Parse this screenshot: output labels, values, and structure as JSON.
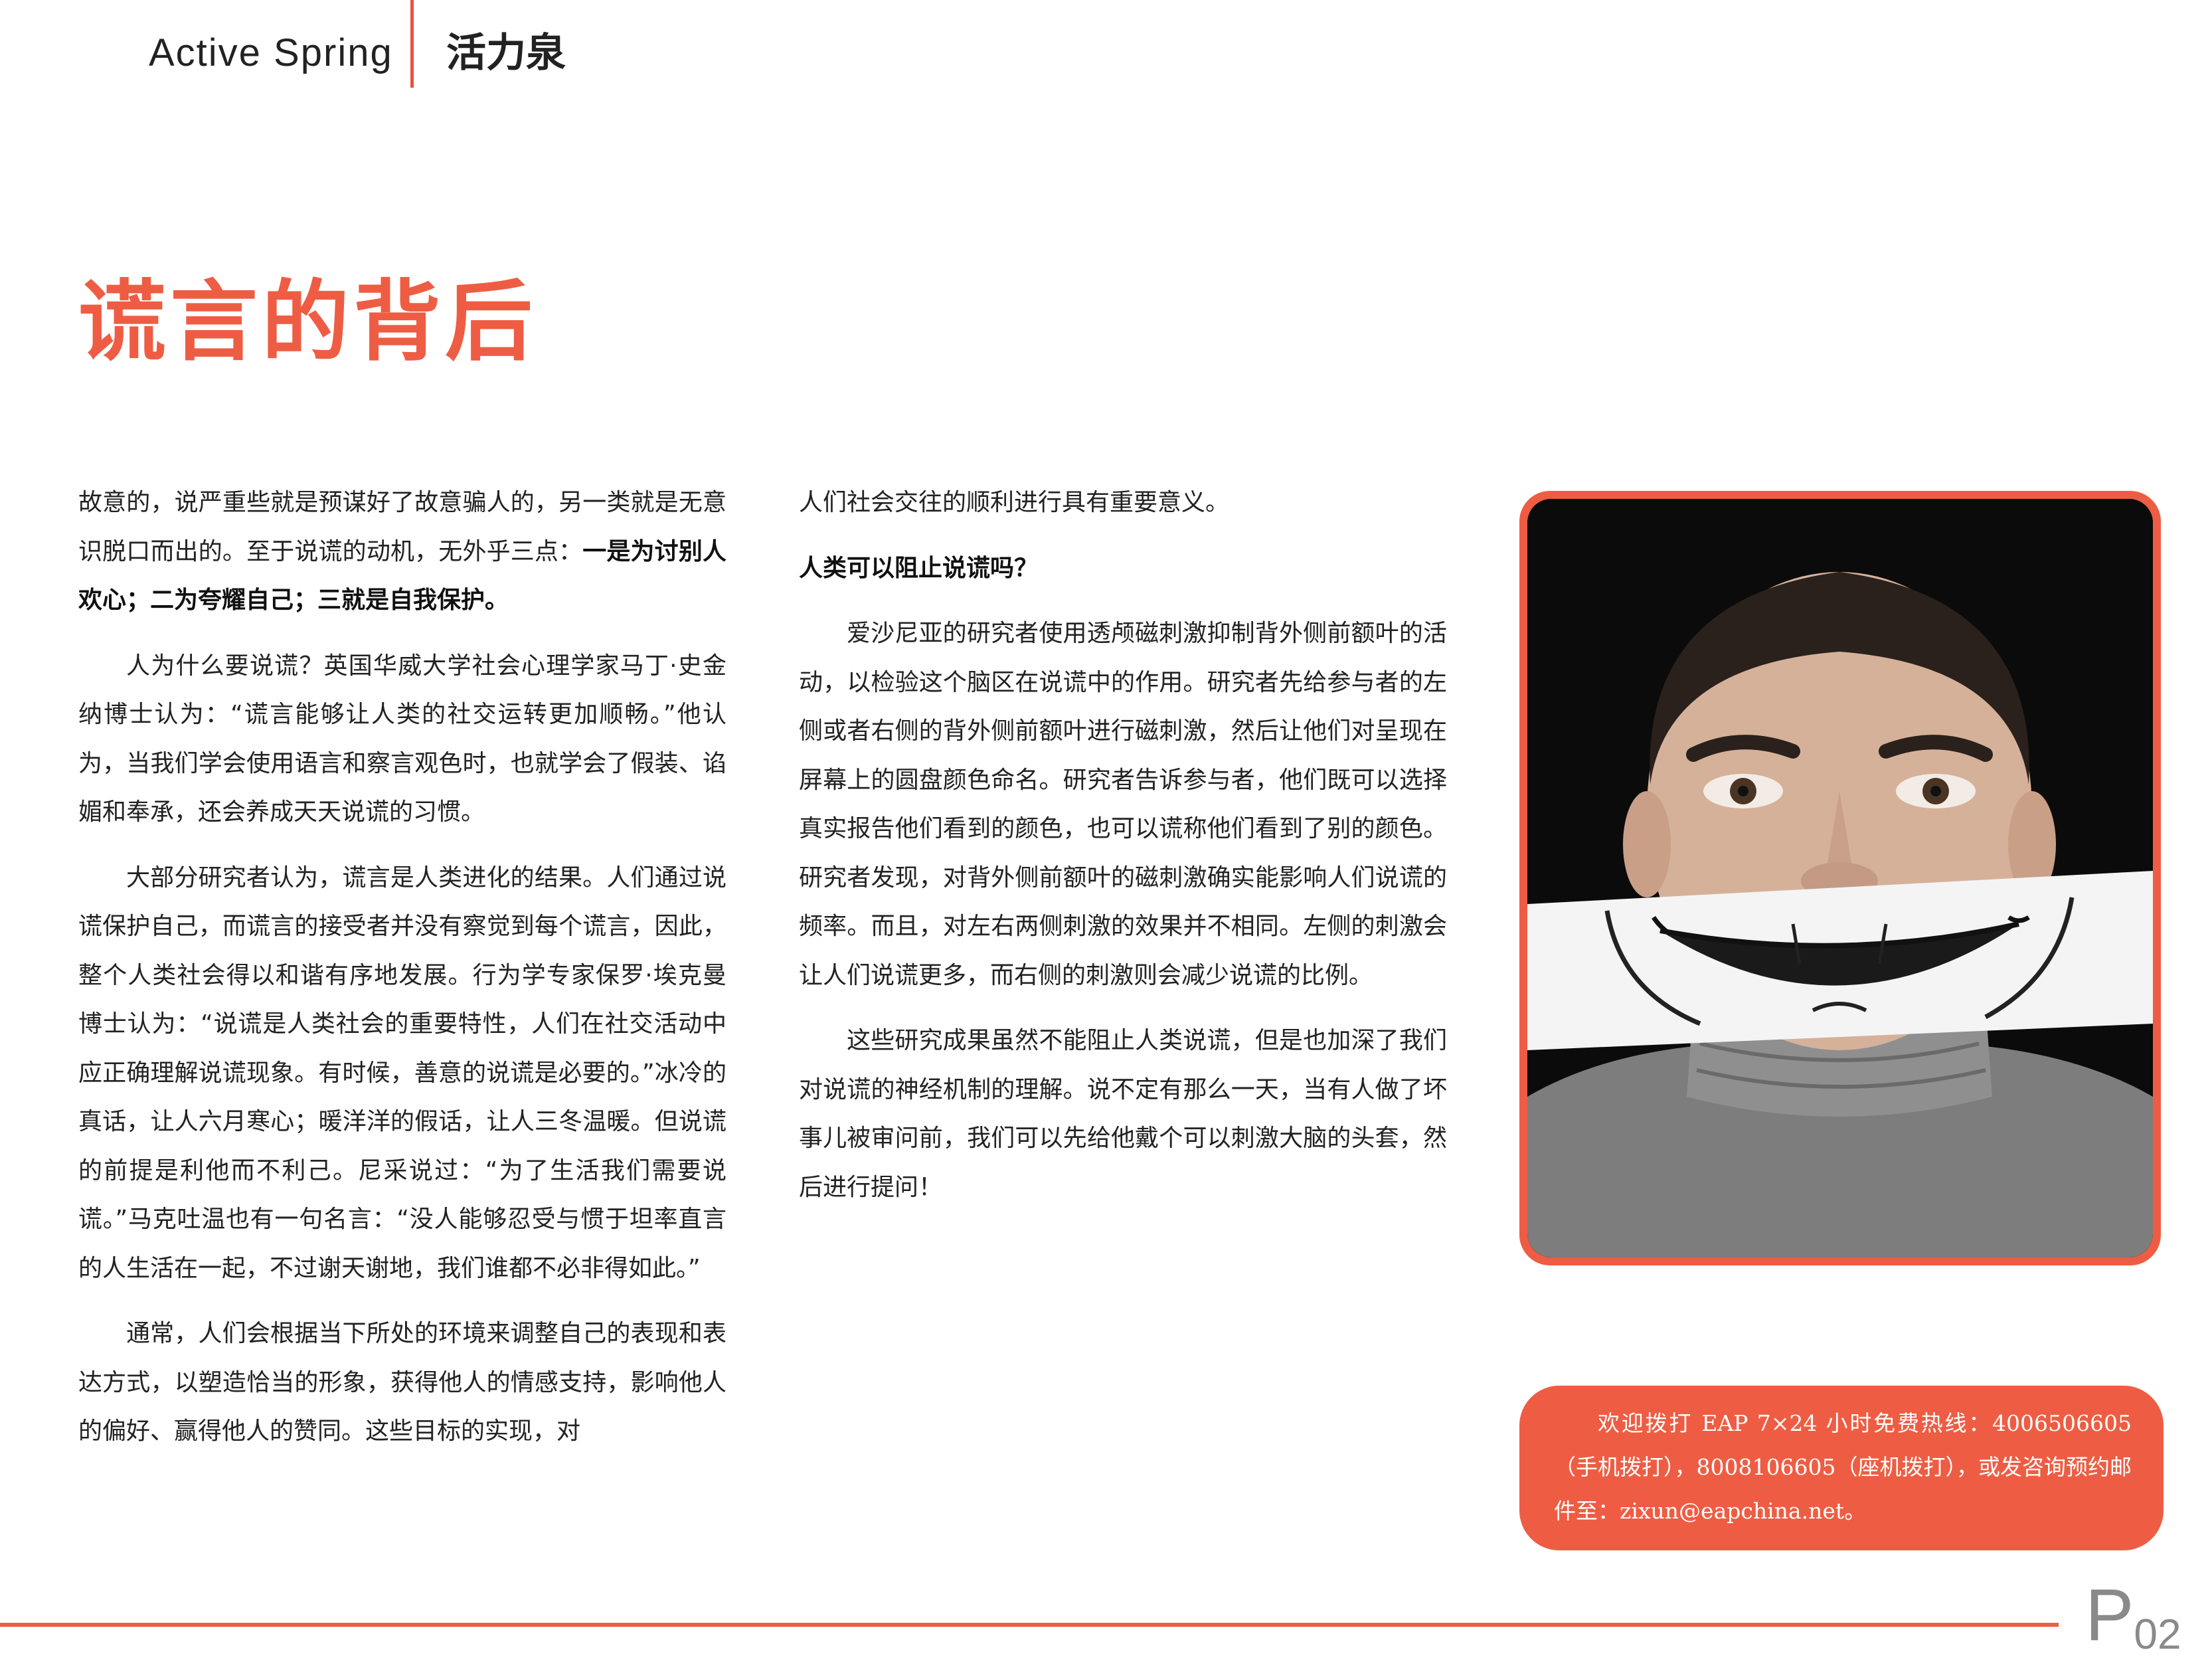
{
  "header": {
    "brand_en": "Active Spring",
    "brand_cn": "活力泉"
  },
  "article": {
    "title": "谎言的背后",
    "col1": {
      "p1_text": "故意的，说严重些就是预谋好了故意骗人的，另一类就是无意识脱口而出的。至于说谎的动机，无外乎三点：",
      "p1_bold": "一是为讨别人欢心；二为夸耀自己；三就是自我保护。",
      "p2": "人为什么要说谎？英国华威大学社会心理学家马丁·史金纳博士认为：“谎言能够让人类的社交运转更加顺畅。”他认为，当我们学会使用语言和察言观色时，也就学会了假装、谄媚和奉承，还会养成天天说谎的习惯。",
      "p3": "大部分研究者认为，谎言是人类进化的结果。人们通过说谎保护自己，而谎言的接受者并没有察觉到每个谎言，因此，整个人类社会得以和谐有序地发展。行为学专家保罗·埃克曼博士认为：“说谎是人类社会的重要特性，人们在社交活动中应正确理解说谎现象。有时候，善意的说谎是必要的。”冰冷的真话，让人六月寒心；暖洋洋的假话，让人三冬温暖。但说谎的前提是利他而不利己。尼采说过：“为了生活我们需要说谎。”马克吐温也有一句名言：“没人能够忍受与惯于坦率直言的人生活在一起，不过谢天谢地，我们谁都不必非得如此。”",
      "p4": "通常，人们会根据当下所处的环境来调整自己的表现和表达方式，以塑造恰当的形象，获得他人的情感支持，影响他人的偏好、赢得他人的赞同。这些目标的实现，对"
    },
    "col2": {
      "p1": "人们社会交往的顺利进行具有重要意义。",
      "heading": "人类可以阻止说谎吗？",
      "p2": "爱沙尼亚的研究者使用透颅磁刺激抑制背外侧前额叶的活动，以检验这个脑区在说谎中的作用。研究者先给参与者的左侧或者右侧的背外侧前额叶进行磁刺激，然后让他们对呈现在屏幕上的圆盘颜色命名。研究者告诉参与者，他们既可以选择真实报告他们看到的颜色，也可以谎称他们看到了别的颜色。研究者发现，对背外侧前额叶的磁刺激确实能影响人们说谎的频率。而且，对左右两侧刺激的效果并不相同。左侧的刺激会让人们说谎更多，而右侧的刺激则会减少说谎的比例。",
      "p3": "这些研究成果虽然不能阻止人类说谎，但是也加深了我们对说谎的神经机制的理解。说不定有那么一天，当有人做了坏事儿被审问前，我们可以先给他戴个可以刺激大脑的头套，然后进行提问！"
    }
  },
  "hotline": {
    "text": "欢迎拨打 EAP 7×24 小时免费热线：4006506605（手机拨打），8008106605（座机拨打），或发咨询预约邮件至：zixun@eapchina.net。"
  },
  "page": {
    "prefix": "P",
    "number": "02"
  },
  "colors": {
    "accent": "#ee5d43",
    "text": "#222222",
    "page_number": "#8a8a8a"
  }
}
